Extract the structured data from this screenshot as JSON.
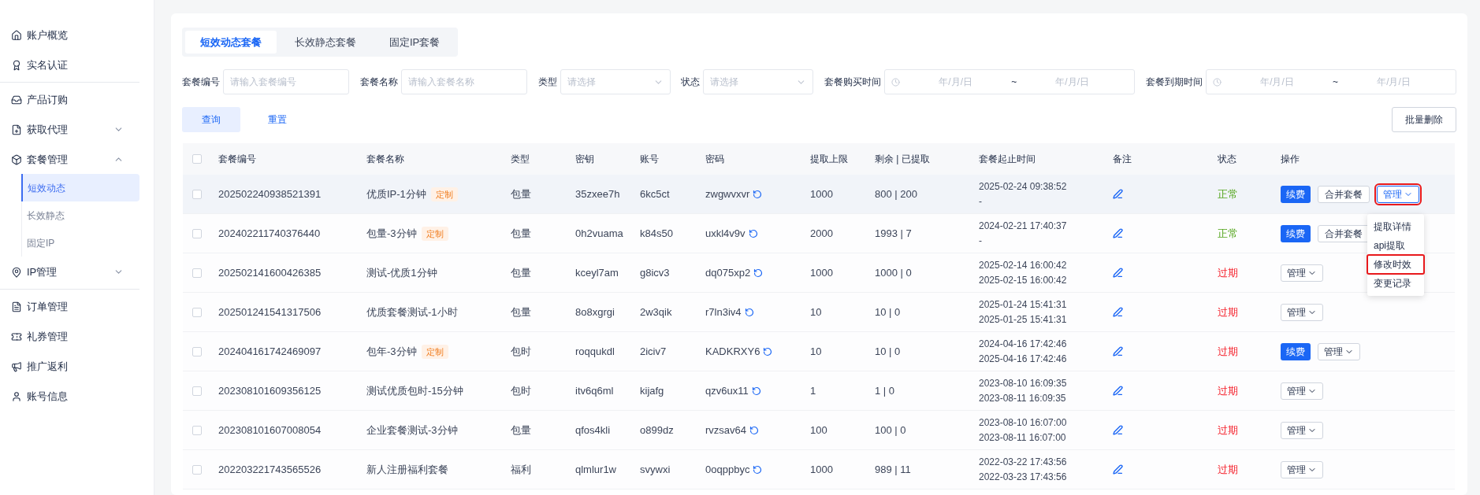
{
  "sidebar": {
    "items": [
      {
        "label": "账户概览",
        "divider_after": false
      },
      {
        "label": "实名认证",
        "divider_after": true
      },
      {
        "label": "产品订购",
        "divider_after": false
      },
      {
        "label": "获取代理",
        "expanded": false,
        "divider_after": false
      },
      {
        "label": "套餐管理",
        "expanded": true,
        "divider_after": false,
        "children": [
          {
            "label": "短效动态",
            "selected": true
          },
          {
            "label": "长效静态",
            "selected": false
          },
          {
            "label": "固定IP",
            "selected": false
          }
        ]
      },
      {
        "label": "IP管理",
        "expanded": false,
        "divider_after": true
      },
      {
        "label": "订单管理",
        "divider_after": false
      },
      {
        "label": "礼券管理",
        "divider_after": false
      },
      {
        "label": "推广返利",
        "divider_after": false
      },
      {
        "label": "账号信息",
        "divider_after": false
      }
    ]
  },
  "tabs": [
    {
      "label": "短效动态套餐",
      "selected": true
    },
    {
      "label": "长效静态套餐",
      "selected": false
    },
    {
      "label": "固定IP套餐",
      "selected": false
    }
  ],
  "filters": [
    {
      "kind": "input",
      "label": "套餐编号",
      "placeholder": "请输入套餐编号"
    },
    {
      "kind": "input",
      "label": "套餐名称",
      "placeholder": "请输入套餐名称"
    },
    {
      "kind": "select",
      "label": "类型",
      "placeholder": "请选择"
    },
    {
      "kind": "select",
      "label": "状态",
      "placeholder": "请选择"
    },
    {
      "kind": "range",
      "label": "套餐购买时间",
      "start_placeholder": "年/月/日",
      "separator": "~",
      "end_placeholder": "年/月/日"
    },
    {
      "kind": "range",
      "label": "套餐到期时间",
      "start_placeholder": "年/月/日",
      "separator": "~",
      "end_placeholder": "年/月/日"
    }
  ],
  "buttons": {
    "query": "查询",
    "reset": "重置",
    "batch_delete": "批量删除"
  },
  "table": {
    "select_all_checked": false,
    "columns": [
      "套餐编号",
      "套餐名称",
      "类型",
      "密钥",
      "账号",
      "密码",
      "提取上限",
      "剩余 | 已提取",
      "套餐起止时间",
      "备注",
      "状态",
      "操作"
    ],
    "rows": [
      {
        "highlighted": true,
        "checked": false,
        "id": "202502240938521391",
        "name": "优质IP-1分钟",
        "tag": "定制",
        "type": "包量",
        "key": "35zxee7h",
        "account": "6kc5ct",
        "password": "zwgwvxvr",
        "limit": "1000",
        "usage": "800 | 200",
        "start": "2025-02-24 09:38:52",
        "end": "-",
        "status": {
          "text": "正常",
          "kind": "normal"
        },
        "actions": [
          {
            "kind": "primary",
            "label": "续费",
            "highlighted": false
          },
          {
            "kind": "outline",
            "label": "合并套餐",
            "highlighted": false
          },
          {
            "kind": "menu",
            "label": "管理",
            "highlighted": true,
            "expanded": true
          }
        ]
      },
      {
        "highlighted": false,
        "checked": false,
        "id": "202402211740376440",
        "name": "包量-3分钟",
        "tag": "定制",
        "type": "包量",
        "key": "0h2vuama",
        "account": "k84s50",
        "password": "uxkl4v9v",
        "limit": "2000",
        "usage": "1993 | 7",
        "start": "2024-02-21 17:40:37",
        "end": "-",
        "status": {
          "text": "正常",
          "kind": "normal"
        },
        "actions": [
          {
            "kind": "primary",
            "label": "续费",
            "highlighted": false
          },
          {
            "kind": "outline",
            "label": "合并套餐",
            "highlighted": false
          }
        ]
      },
      {
        "highlighted": false,
        "checked": false,
        "id": "202502141600426385",
        "name": "测试-优质1分钟",
        "type": "包量",
        "key": "kceyl7am",
        "account": "g8icv3",
        "password": "dq075xp2",
        "limit": "1000",
        "usage": "1000 | 0",
        "start": "2025-02-14 16:00:42",
        "end": "2025-02-15 16:00:42",
        "status": {
          "text": "过期",
          "kind": "expired"
        },
        "actions": [
          {
            "kind": "menu",
            "label": "管理",
            "highlighted": false,
            "expanded": false
          }
        ]
      },
      {
        "highlighted": false,
        "checked": false,
        "id": "202501241541317506",
        "name": "优质套餐测试-1小时",
        "type": "包量",
        "key": "8o8xgrgi",
        "account": "2w3qik",
        "password": "r7ln3iv4",
        "limit": "10",
        "usage": "10 | 0",
        "start": "2025-01-24 15:41:31",
        "end": "2025-01-25 15:41:31",
        "status": {
          "text": "过期",
          "kind": "expired"
        },
        "actions": [
          {
            "kind": "menu",
            "label": "管理",
            "highlighted": false,
            "expanded": false
          }
        ]
      },
      {
        "highlighted": false,
        "checked": false,
        "id": "202404161742469097",
        "name": "包年-3分钟",
        "tag": "定制",
        "type": "包时",
        "key": "roqqukdl",
        "account": "2iciv7",
        "password": "KADKRXY6",
        "limit": "10",
        "usage": "10 | 0",
        "start": "2024-04-16 17:42:46",
        "end": "2025-04-16 17:42:46",
        "status": {
          "text": "过期",
          "kind": "expired"
        },
        "actions": [
          {
            "kind": "primary",
            "label": "续费",
            "highlighted": false
          },
          {
            "kind": "menu",
            "label": "管理",
            "highlighted": false,
            "expanded": false
          }
        ]
      },
      {
        "highlighted": false,
        "checked": false,
        "id": "202308101609356125",
        "name": "测试优质包时-15分钟",
        "type": "包时",
        "key": "itv6q6ml",
        "account": "kijafg",
        "password": "qzv6ux11",
        "limit": "1",
        "usage": "1 | 0",
        "start": "2023-08-10 16:09:35",
        "end": "2023-08-11 16:09:35",
        "status": {
          "text": "过期",
          "kind": "expired"
        },
        "actions": [
          {
            "kind": "menu",
            "label": "管理",
            "highlighted": false,
            "expanded": false
          }
        ]
      },
      {
        "highlighted": false,
        "checked": false,
        "id": "202308101607008054",
        "name": "企业套餐测试-3分钟",
        "type": "包量",
        "key": "qfos4kli",
        "account": "o899dz",
        "password": "rvzsav64",
        "limit": "100",
        "usage": "100 | 0",
        "start": "2023-08-10 16:07:00",
        "end": "2023-08-11 16:07:00",
        "status": {
          "text": "过期",
          "kind": "expired"
        },
        "actions": [
          {
            "kind": "menu",
            "label": "管理",
            "highlighted": false,
            "expanded": false
          }
        ]
      },
      {
        "highlighted": false,
        "checked": false,
        "id": "202203221743565526",
        "name": "新人注册福利套餐",
        "type": "福利",
        "key": "qlmlur1w",
        "account": "svywxi",
        "password": "0oqppbyc",
        "limit": "1000",
        "usage": "989 | 11",
        "start": "2022-03-22 17:43:56",
        "end": "2022-03-23 17:43:56",
        "status": {
          "text": "过期",
          "kind": "expired"
        },
        "actions": [
          {
            "kind": "menu",
            "label": "管理",
            "highlighted": false,
            "expanded": false
          }
        ]
      }
    ]
  },
  "manage_menu": {
    "items": [
      {
        "label": "提取详情",
        "highlighted": false
      },
      {
        "label": "api提取",
        "highlighted": false
      },
      {
        "label": "修改时效",
        "highlighted": true
      },
      {
        "label": "变更记录",
        "highlighted": false
      }
    ]
  }
}
